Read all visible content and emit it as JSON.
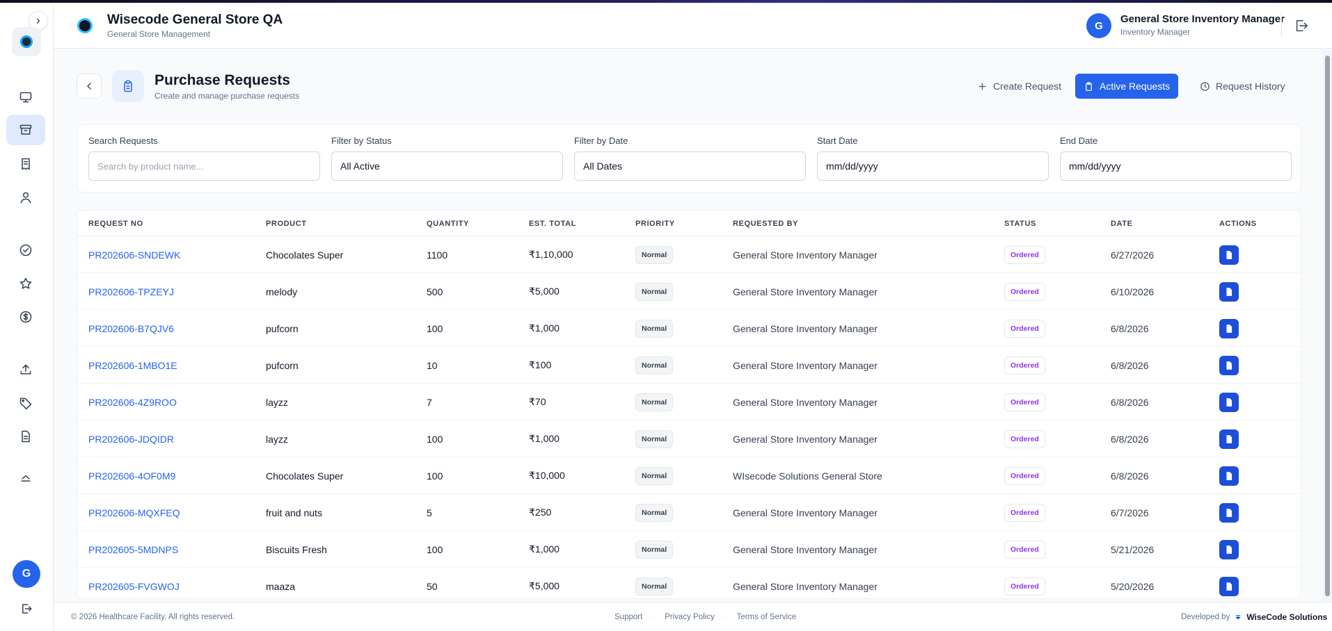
{
  "header": {
    "brand_title": "Wisecode General Store QA",
    "brand_subtitle": "General Store Management",
    "user_initial": "G",
    "user_name": "General Store Inventory Manager",
    "user_role": "Inventory Manager"
  },
  "sidebar": {
    "items": [
      {
        "icon": "monitor-icon",
        "active": false
      },
      {
        "icon": "archive-box-icon",
        "active": true
      },
      {
        "icon": "receipt-icon",
        "active": false
      },
      {
        "icon": "user-icon",
        "active": false
      },
      {
        "icon": "check-circle-icon",
        "active": false
      },
      {
        "icon": "star-icon",
        "active": false
      },
      {
        "icon": "dollar-circle-icon",
        "active": false
      },
      {
        "icon": "upload-icon",
        "active": false
      },
      {
        "icon": "tag-icon",
        "active": false
      },
      {
        "icon": "document-icon",
        "active": false
      },
      {
        "icon": "chevron-up-icon",
        "active": false
      }
    ],
    "avatar_initial": "G"
  },
  "page": {
    "title": "Purchase Requests",
    "subtitle": "Create and manage purchase requests",
    "tabs": {
      "create": "Create Request",
      "active": "Active Requests",
      "history": "Request History"
    }
  },
  "filters": {
    "search_label": "Search Requests",
    "search_placeholder": "Search by product name...",
    "status_label": "Filter by Status",
    "status_value": "All Active",
    "date_label": "Filter by Date",
    "date_value": "All Dates",
    "start_label": "Start Date",
    "start_value": "mm/dd/yyyy",
    "end_label": "End Date",
    "end_value": "mm/dd/yyyy"
  },
  "table": {
    "headers": {
      "request_no": "REQUEST NO",
      "product": "PRODUCT",
      "quantity": "QUANTITY",
      "est_total": "EST. TOTAL",
      "priority": "PRIORITY",
      "requested_by": "REQUESTED BY",
      "status": "STATUS",
      "date": "DATE",
      "actions": "ACTIONS"
    },
    "rows": [
      {
        "request_no": "PR202606-SNDEWK",
        "product": "Chocolates Super",
        "quantity": "1100",
        "est_total": "₹1,10,000",
        "priority": "Normal",
        "requested_by": "General Store Inventory Manager",
        "status": "Ordered",
        "date": "6/27/2026"
      },
      {
        "request_no": "PR202606-TPZEYJ",
        "product": "melody",
        "quantity": "500",
        "est_total": "₹5,000",
        "priority": "Normal",
        "requested_by": "General Store Inventory Manager",
        "status": "Ordered",
        "date": "6/10/2026"
      },
      {
        "request_no": "PR202606-B7QJV6",
        "product": "pufcorn",
        "quantity": "100",
        "est_total": "₹1,000",
        "priority": "Normal",
        "requested_by": "General Store Inventory Manager",
        "status": "Ordered",
        "date": "6/8/2026"
      },
      {
        "request_no": "PR202606-1MBO1E",
        "product": "pufcorn",
        "quantity": "10",
        "est_total": "₹100",
        "priority": "Normal",
        "requested_by": "General Store Inventory Manager",
        "status": "Ordered",
        "date": "6/8/2026"
      },
      {
        "request_no": "PR202606-4Z9ROO",
        "product": "layzz",
        "quantity": "7",
        "est_total": "₹70",
        "priority": "Normal",
        "requested_by": "General Store Inventory Manager",
        "status": "Ordered",
        "date": "6/8/2026"
      },
      {
        "request_no": "PR202606-JDQIDR",
        "product": "layzz",
        "quantity": "100",
        "est_total": "₹1,000",
        "priority": "Normal",
        "requested_by": "General Store Inventory Manager",
        "status": "Ordered",
        "date": "6/8/2026"
      },
      {
        "request_no": "PR202606-4OF0M9",
        "product": "Chocolates Super",
        "quantity": "100",
        "est_total": "₹10,000",
        "priority": "Normal",
        "requested_by": "WIsecode Solutions General Store",
        "status": "Ordered",
        "date": "6/8/2026"
      },
      {
        "request_no": "PR202606-MQXFEQ",
        "product": "fruit and nuts",
        "quantity": "5",
        "est_total": "₹250",
        "priority": "Normal",
        "requested_by": "General Store Inventory Manager",
        "status": "Ordered",
        "date": "6/7/2026"
      },
      {
        "request_no": "PR202605-5MDNPS",
        "product": "Biscuits Fresh",
        "quantity": "100",
        "est_total": "₹1,000",
        "priority": "Normal",
        "requested_by": "General Store Inventory Manager",
        "status": "Ordered",
        "date": "5/21/2026"
      },
      {
        "request_no": "PR202605-FVGWOJ",
        "product": "maaza",
        "quantity": "50",
        "est_total": "₹5,000",
        "priority": "Normal",
        "requested_by": "General Store Inventory Manager",
        "status": "Ordered",
        "date": "5/20/2026"
      }
    ]
  },
  "footer": {
    "copyright": "© 2026 Healthcare Facility. All rights reserved.",
    "support": "Support",
    "privacy": "Privacy Policy",
    "terms": "Terms of Service",
    "developed_by": "Developed by",
    "developer": "WiseCode Solutions"
  },
  "colors": {
    "primary": "#2563eb",
    "status_ordered": "#9333ea"
  }
}
